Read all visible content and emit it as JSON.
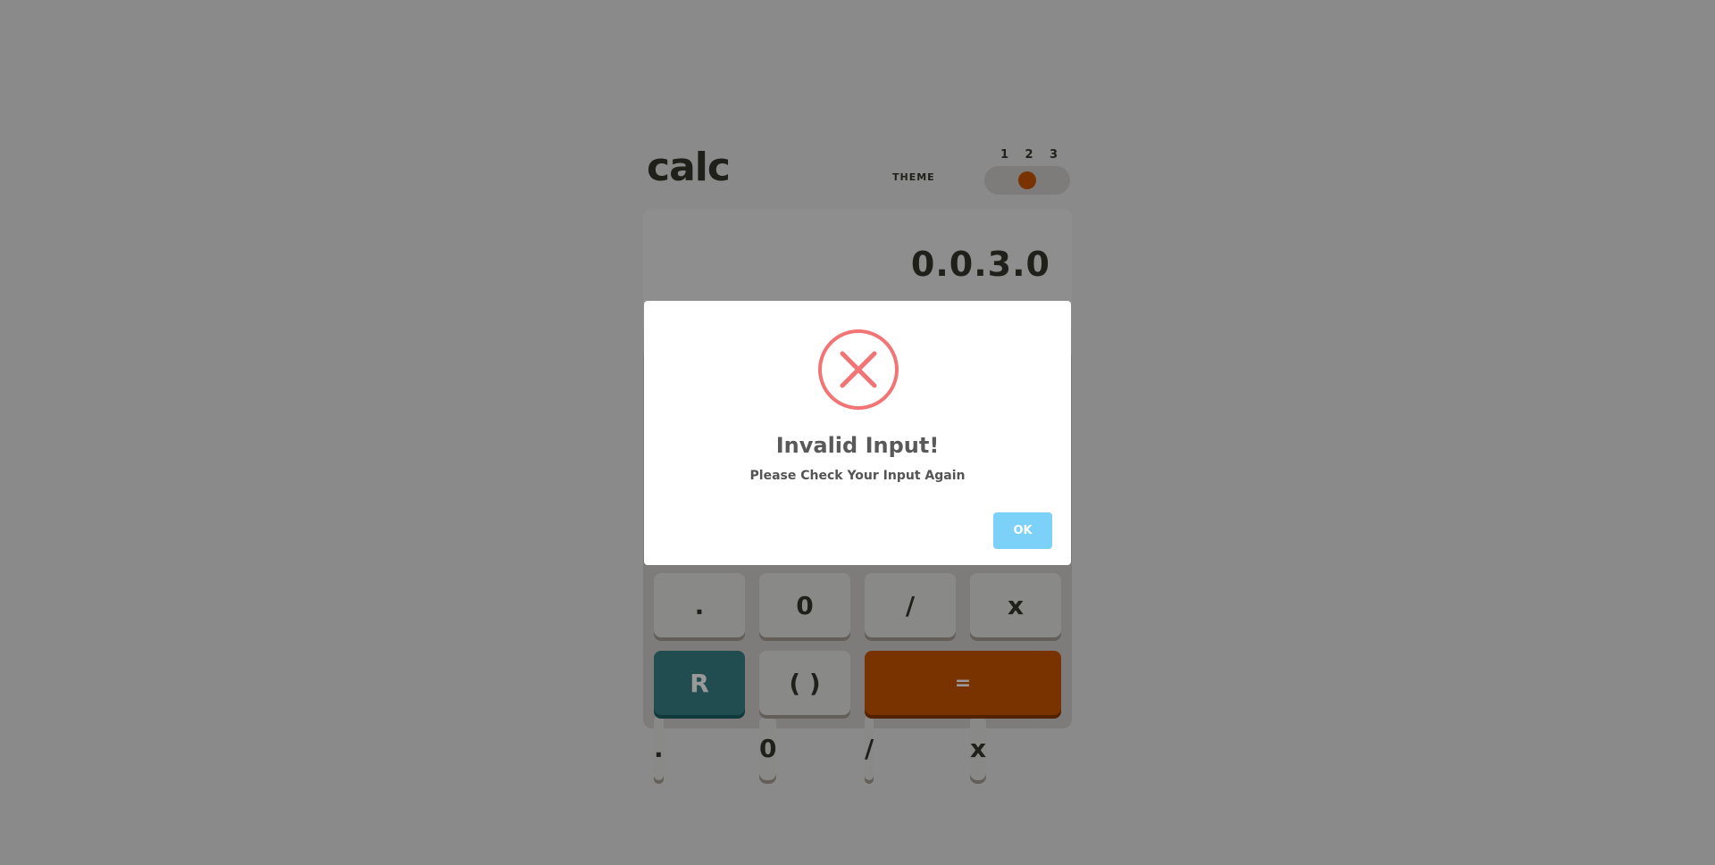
{
  "app": {
    "logo": "calc",
    "theme_label": "THEME",
    "theme_options": [
      "1",
      "2",
      "3"
    ],
    "theme_selected": "2",
    "display_value": "0.0.3.0"
  },
  "keypad": {
    "row4": [
      ".",
      "0",
      "/",
      "x"
    ],
    "reset_label": "R",
    "paren_label": "( )",
    "equals_label": "="
  },
  "dialog": {
    "icon": "error-x-icon",
    "title": "Invalid Input!",
    "message": "Please Check Your Input Again",
    "ok_label": "OK"
  },
  "colors": {
    "accent": "#ca5502",
    "reset": "#377f86",
    "error": "#f27474",
    "ok_button": "#7cd1f9"
  }
}
